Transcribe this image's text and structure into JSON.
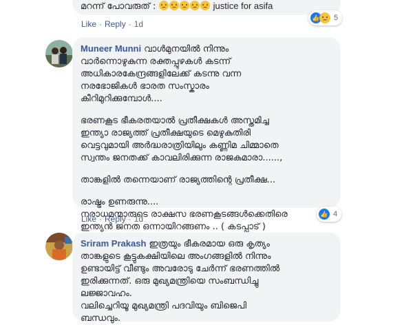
{
  "comment_top": {
    "text": "മറന്ന് പോവരുത് :",
    "hashtag": "justice for asifa",
    "emojis": [
      "crying-face",
      "crying-face",
      "crying-face",
      "crying-face",
      "crying-face"
    ],
    "actions": {
      "like": "Like",
      "reply": "Reply",
      "time": "1d"
    },
    "reaction_count": "5"
  },
  "comment_muneer": {
    "author": "Muneer Munni",
    "paragraph1": [
      "വാൾമുനയിൽ നിന്നും",
      "വാർന്നൊഴുകുന്ന രക്തപ്പുഴകൾ കടന്ന്",
      "അധികാരകേന്ദ്രങ്ങളിലേക്ക് കടന്നു വന്ന",
      "നരഭോജികൾ ഭാരത സംസ്കാരം",
      "കീറിമുറിക്കുമ്പോൾ...."
    ],
    "paragraph2": [
      "ഭരണകൂട ഭീകരതയാൽ പ്രതീക്ഷകൾ അസ്തമിച്ച",
      "ഇന്ത്യാ രാജ്യത്ത് പ്രതീക്ഷയുടെ മെഴുകുതിരി",
      "വെട്ടവുമായി അർദ്ധരാത്രിയിലും കണ്ണിമ ചിമ്മാതെ",
      "സ്വന്തം ജനതക്ക് കാവലിരിക്കുന്ന രാജകുമാരാ......,"
    ],
    "paragraph3": [
      "താങ്കളിൽ തന്നെയാണ് രാജ്യത്തിന്റെ പ്രതീക്ഷ..."
    ],
    "paragraph4": [
      "രാഷ്ട്രം ഉണരുന്നു....",
      "നരാധമന്മാരുടെ രാക്ഷസ ഭരണകൂടങ്ങൾക്കെതിരെ",
      "ഇന്ത്യൻ ജനത ഒന്നായിറങ്ങണം .. ( കടപ്പാട് )"
    ],
    "actions": {
      "like": "Like",
      "reply": "Reply",
      "time": "1d"
    },
    "reaction_count": "4"
  },
  "comment_sriram": {
    "author": "Sriram Prakash",
    "first_line": "ഇത്രയും ഭീകരമായ ഒരു കൃത്യം",
    "lines": [
      "താങ്കളുടെ കൂട്ടുകക്ഷിയിലെ അംഗങ്ങളിൽ നിന്നും",
      "ഉണ്ടായിട്ട് വീണ്ടും അവരോടു ചേർന്ന് ഭരണത്തിൽ",
      "ഇരിക്കുന്നത്. ഒരു മുഖ്യമന്ത്രിയെ സംബന്ധിച്ചു",
      "ലജ്ജാവഹം.",
      "വലിച്ചെറിയൂ മുഖ്യമന്ത്രി പദവിയും ബിജെപി",
      "ബന്ധവും."
    ]
  }
}
